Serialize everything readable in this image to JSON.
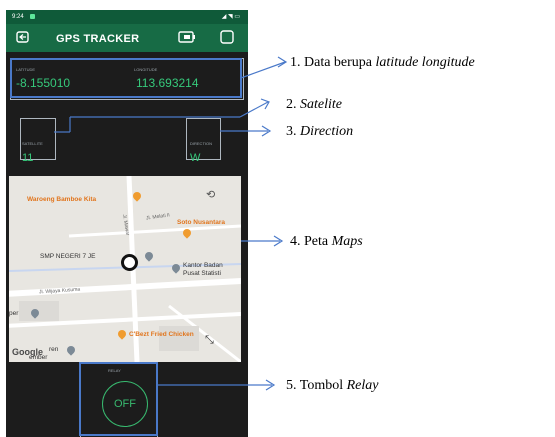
{
  "statusbar": {
    "time": "9:24",
    "icons": "◢ ◥ ▭"
  },
  "appbar": {
    "title": "GPS TRACKER",
    "left_icon": "exit-icon",
    "right_icons": [
      "battery-icon",
      "square-icon"
    ]
  },
  "location": {
    "latitude_label": "LATITUDE",
    "latitude_value": "-8.155010",
    "longitude_label": "LONGITUDE",
    "longitude_value": "113.693214"
  },
  "satelite": {
    "label": "SATELLITE",
    "value": "11"
  },
  "direction": {
    "label": "DIRECTION",
    "value": "W"
  },
  "map": {
    "places": {
      "waroeng": "Waroeng Bamboe Kita",
      "soto": "Soto Nusantara",
      "smp": "SMP NEGERI 7 JE",
      "kantor1": "Kantor Badan",
      "kantor2": "Pusat Statisti",
      "cbezt": "C'Bezt Fried Chicken",
      "per": "per",
      "resto": "ren",
      "jember": "ember",
      "street1": "Jl. Mawar",
      "street2": "Jl. Melati II",
      "street3": "Jl. Wijaya Kusuma"
    },
    "google": "Google"
  },
  "relay": {
    "label": "RELAY",
    "button": "OFF"
  },
  "annotations": {
    "a1_prefix": "1. Data berupa ",
    "a1_italic": "latitude longitude",
    "a2_prefix": "2. ",
    "a2_italic": "Satelite",
    "a3_prefix": "3. ",
    "a3_italic": "Direction",
    "a4_prefix": "4. Peta ",
    "a4_italic": "Maps",
    "a5_prefix": "5. Tombol ",
    "a5_italic": "Relay"
  },
  "colors": {
    "appbar": "#176b45",
    "accent": "#36c97b",
    "highlight": "#4a79c9"
  }
}
